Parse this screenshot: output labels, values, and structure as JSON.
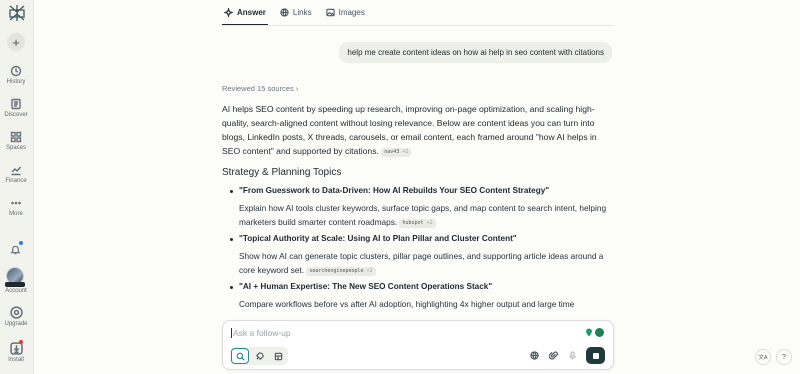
{
  "sidebar": {
    "new_label": "+",
    "items": [
      {
        "label": "History",
        "icon": "history-icon"
      },
      {
        "label": "Discover",
        "icon": "discover-icon"
      },
      {
        "label": "Spaces",
        "icon": "spaces-icon"
      },
      {
        "label": "Finance",
        "icon": "finance-icon"
      },
      {
        "label": "More",
        "icon": "more-icon"
      }
    ],
    "account_label": "Account",
    "upgrade_label": "Upgrade",
    "install_label": "Install"
  },
  "tabs": [
    {
      "label": "Answer",
      "icon": "answer-icon",
      "active": true
    },
    {
      "label": "Links",
      "icon": "globe-icon",
      "active": false
    },
    {
      "label": "Images",
      "icon": "image-icon",
      "active": false
    }
  ],
  "query": "help me create content ideas on how ai help in seo content with citations",
  "reviewed": "Reviewed 15 sources",
  "answer": {
    "intro": "AI helps SEO content by speeding up research, improving on-page optimization, and scaling high-quality, search-aligned content without losing relevance. Below are content ideas you can turn into blogs, LinkedIn posts, X threads, carousels, or email content, each framed around \"how AI helps in SEO content\" and supported by citations.",
    "intro_cite": {
      "source": "nav43",
      "count": "+2"
    },
    "section_title": "Strategy & Planning Topics",
    "items": [
      {
        "title": "\"From Guesswork to Data-Driven: How AI Rebuilds Your SEO Content Strategy\"",
        "desc": "Explain how AI tools cluster keywords, surface topic gaps, and map content to search intent, helping marketers build smarter content roadmaps.",
        "cite": {
          "source": "hubspot",
          "count": "+2"
        }
      },
      {
        "title": "\"Topical Authority at Scale: Using AI to Plan Pillar and Cluster Content\"",
        "desc": "Show how AI can generate topic clusters, pillar page outlines, and supporting article ideas around a core keyword set.",
        "cite": {
          "source": "searchenginepeople",
          "count": "+2"
        }
      },
      {
        "title": "\"AI + Human Expertise: The New SEO Content Operations Stack\"",
        "desc": "Compare workflows before vs after AI adoption, highlighting 4x higher output and large time"
      }
    ]
  },
  "followup": {
    "placeholder": "Ask a follow-up"
  },
  "corner": {
    "translate": "文A",
    "help": "?"
  }
}
